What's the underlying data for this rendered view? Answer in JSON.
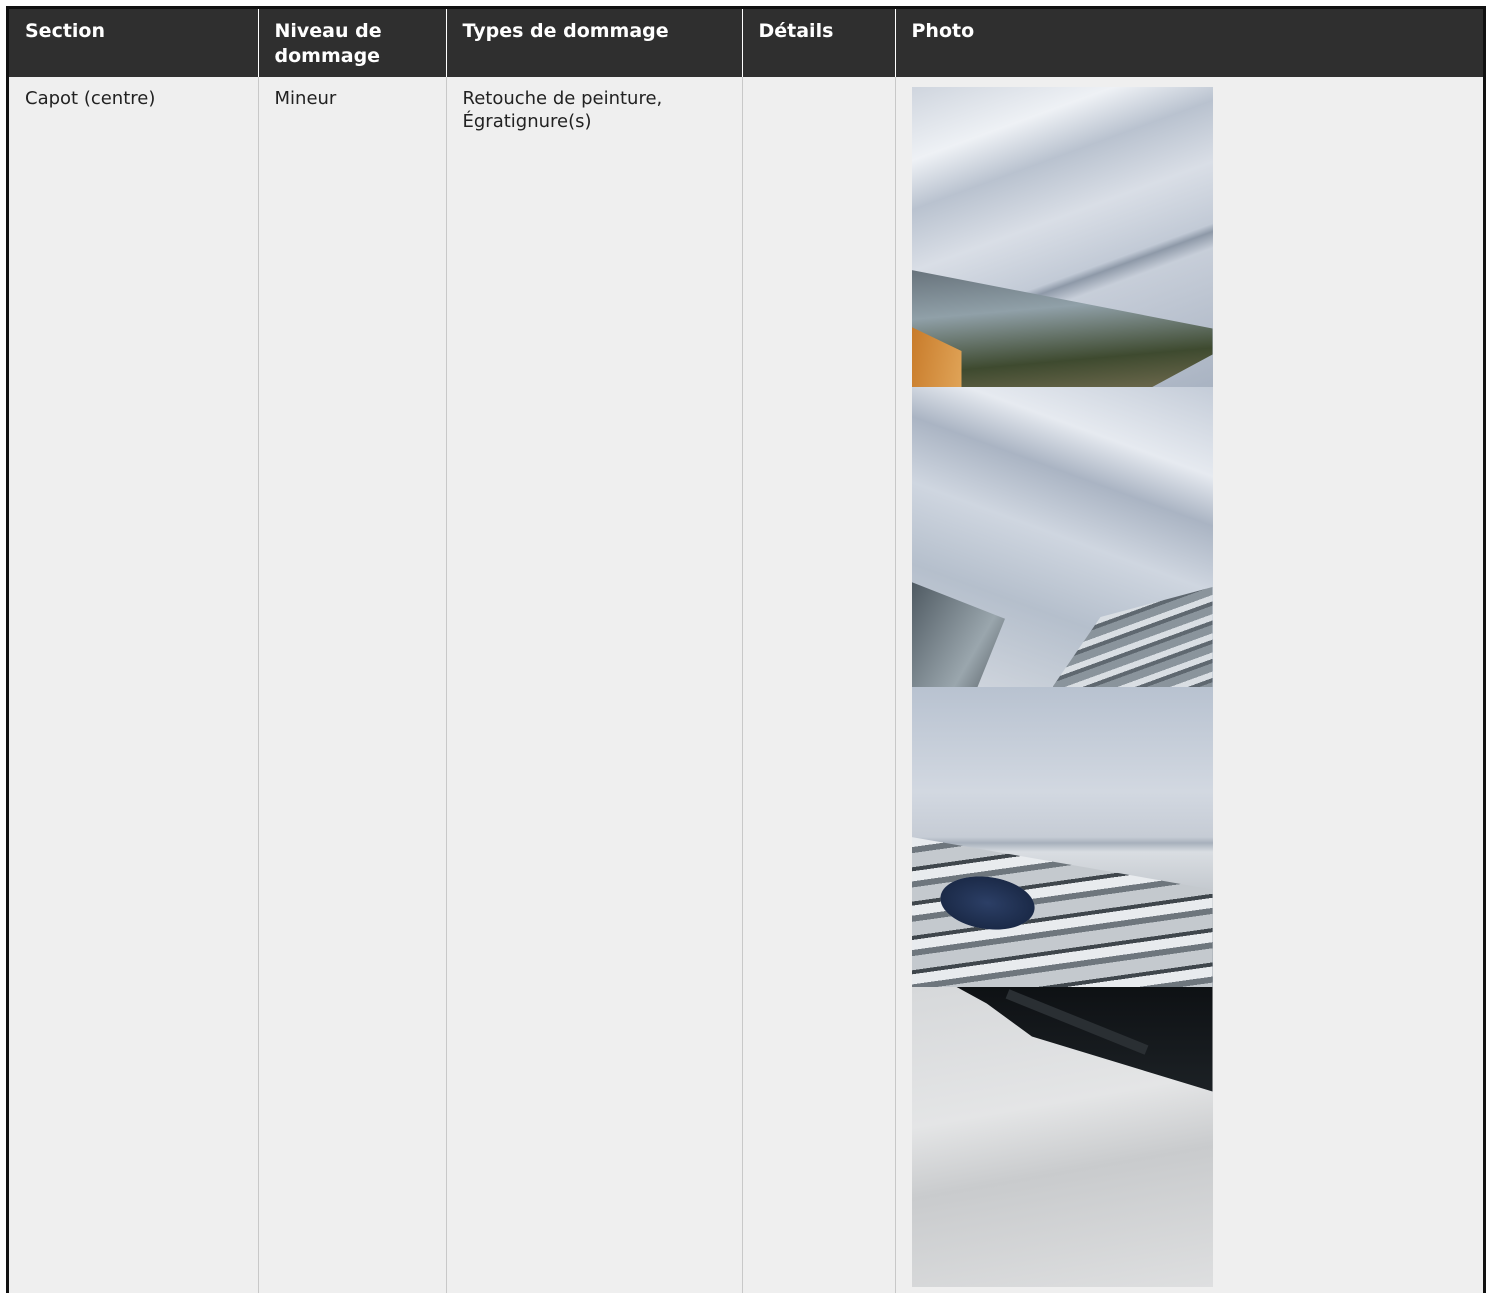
{
  "table": {
    "headers": [
      "Section",
      "Niveau de dommage",
      "Types de dommage",
      "Détails",
      "Photo"
    ],
    "rows": [
      {
        "section": "Capot (centre)",
        "niveau": "Mineur",
        "types": "Retouche de peinture, Égratignure(s)",
        "details": "",
        "photos": [
          "hood-headlight-photo",
          "hood-grille-photo",
          "hood-emblem-photo",
          "hood-wiper-photo"
        ]
      }
    ]
  }
}
